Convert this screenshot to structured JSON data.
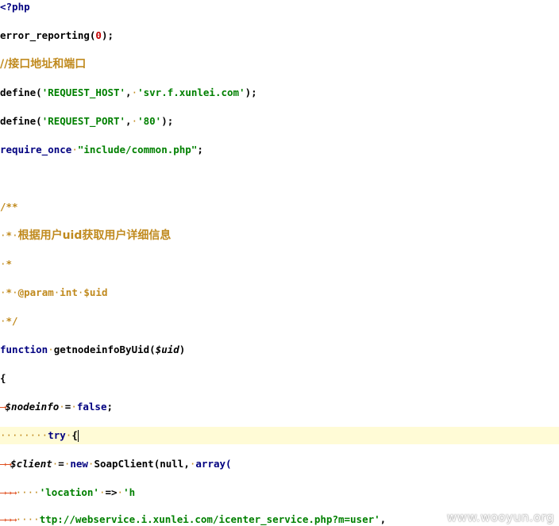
{
  "lines": {
    "l1": {
      "open": "<?php"
    },
    "l2": {
      "fn": "error_reporting(",
      "num": "0",
      "tail": ");"
    },
    "l3": {
      "comment": "//接口地址和端口"
    },
    "l4": {
      "fn": "define(",
      "a": "'REQUEST_HOST'",
      "sep": ",",
      "b": "'svr.f.xunlei.com'",
      "tail": ");"
    },
    "l5": {
      "fn": "define(",
      "a": "'REQUEST_PORT'",
      "sep": ",",
      "b": "'80'",
      "tail": ");"
    },
    "l6": {
      "kw": "require_once",
      "str": "\"include/common.php\"",
      "tail": ";"
    },
    "l7": {
      "comment": "/**"
    },
    "l8": {
      "star": "*",
      "comment": "根据用户uid获取用户详细信息"
    },
    "l9": {
      "star": "*"
    },
    "l10": {
      "star": "*",
      "tag": "@param",
      "type": "int",
      "var": "$uid"
    },
    "l11": {
      "comment": "*/"
    },
    "l12": {
      "kw": "function",
      "name": "getnodeinfoByUid(",
      "var": "$uid",
      "tail": ")"
    },
    "l13": {
      "brace": "{"
    },
    "l14": {
      "var": "$nodeinfo",
      "eq": "=",
      "kw": "false",
      "tail": ";"
    },
    "l15": {
      "kw": "try",
      "brace": "{"
    },
    "l16": {
      "var": "$client",
      "eq": "=",
      "kw": "new",
      "cls": "SoapClient(null,",
      "kw2": "array("
    },
    "l17": {
      "str": "'location'",
      "op": "=>",
      "str2": "'h"
    },
    "l18": {
      "str": "ttp://webservice.i.xunlei.com/icenter_service.php?m=user'",
      "tail": ","
    }
  },
  "watermark": "www.wooyun.org",
  "colors": {
    "highlight_line": "#fffbd6",
    "comment": "#c08a1e",
    "string": "#008000",
    "keyword": "#000080",
    "number": "#c00000",
    "tab_arrow": "#e05020"
  }
}
